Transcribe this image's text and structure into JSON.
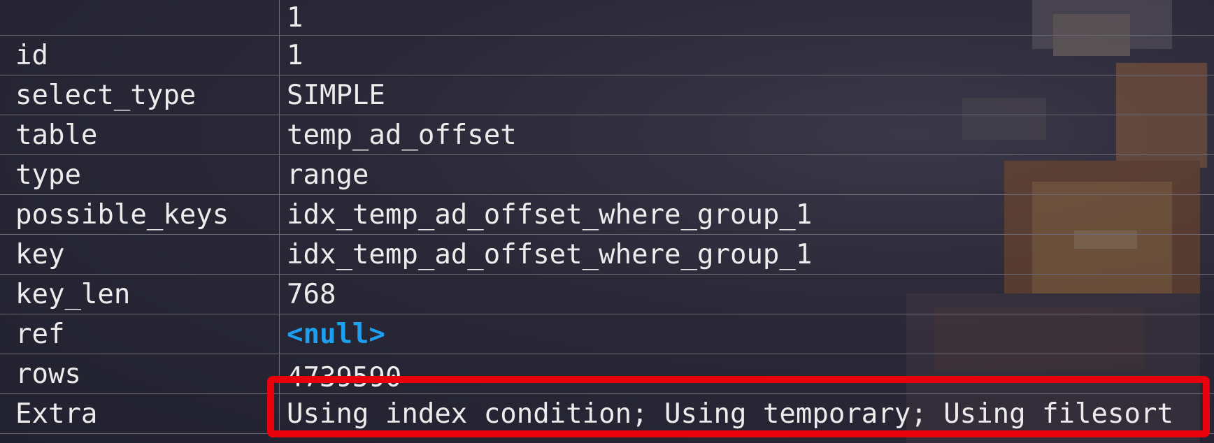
{
  "result": {
    "column_header": "1",
    "rows": [
      {
        "key": "id",
        "value": "1",
        "is_null": false
      },
      {
        "key": "select_type",
        "value": "SIMPLE",
        "is_null": false
      },
      {
        "key": "table",
        "value": "temp_ad_offset",
        "is_null": false
      },
      {
        "key": "type",
        "value": "range",
        "is_null": false
      },
      {
        "key": "possible_keys",
        "value": "idx_temp_ad_offset_where_group_1",
        "is_null": false
      },
      {
        "key": "key",
        "value": "idx_temp_ad_offset_where_group_1",
        "is_null": false
      },
      {
        "key": "key_len",
        "value": "768",
        "is_null": false
      },
      {
        "key": "ref",
        "value": "<null>",
        "is_null": true
      },
      {
        "key": "rows",
        "value": "4739590",
        "is_null": false
      },
      {
        "key": "Extra",
        "value": "Using index condition; Using temporary; Using filesort",
        "is_null": false
      }
    ]
  },
  "colors": {
    "null_value": "#1f9ff0",
    "highlight": "#e8000a",
    "grid_line": "#6b6a74",
    "text": "#ececec"
  }
}
